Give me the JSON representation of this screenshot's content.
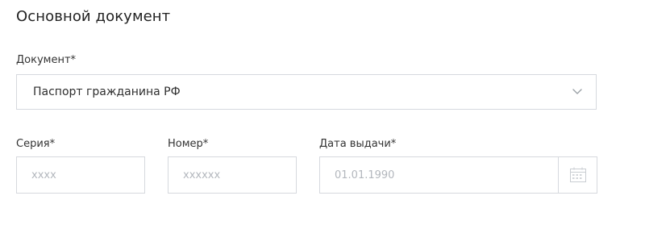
{
  "section": {
    "title": "Основной документ"
  },
  "document": {
    "label": "Документ*",
    "selected_value": "Паспорт гражданина РФ"
  },
  "series": {
    "label": "Серия*",
    "placeholder": "xxxx",
    "value": ""
  },
  "number": {
    "label": "Номер*",
    "placeholder": "xxxxxx",
    "value": ""
  },
  "issue_date": {
    "label": "Дата выдачи*",
    "placeholder": "01.01.1990",
    "value": ""
  },
  "icons": {
    "select_chevron": "chevron-down-icon",
    "date_picker": "calendar-icon"
  },
  "colors": {
    "border": "#d6d9de",
    "text": "#2e2e2e",
    "placeholder": "#b3b7bd"
  }
}
